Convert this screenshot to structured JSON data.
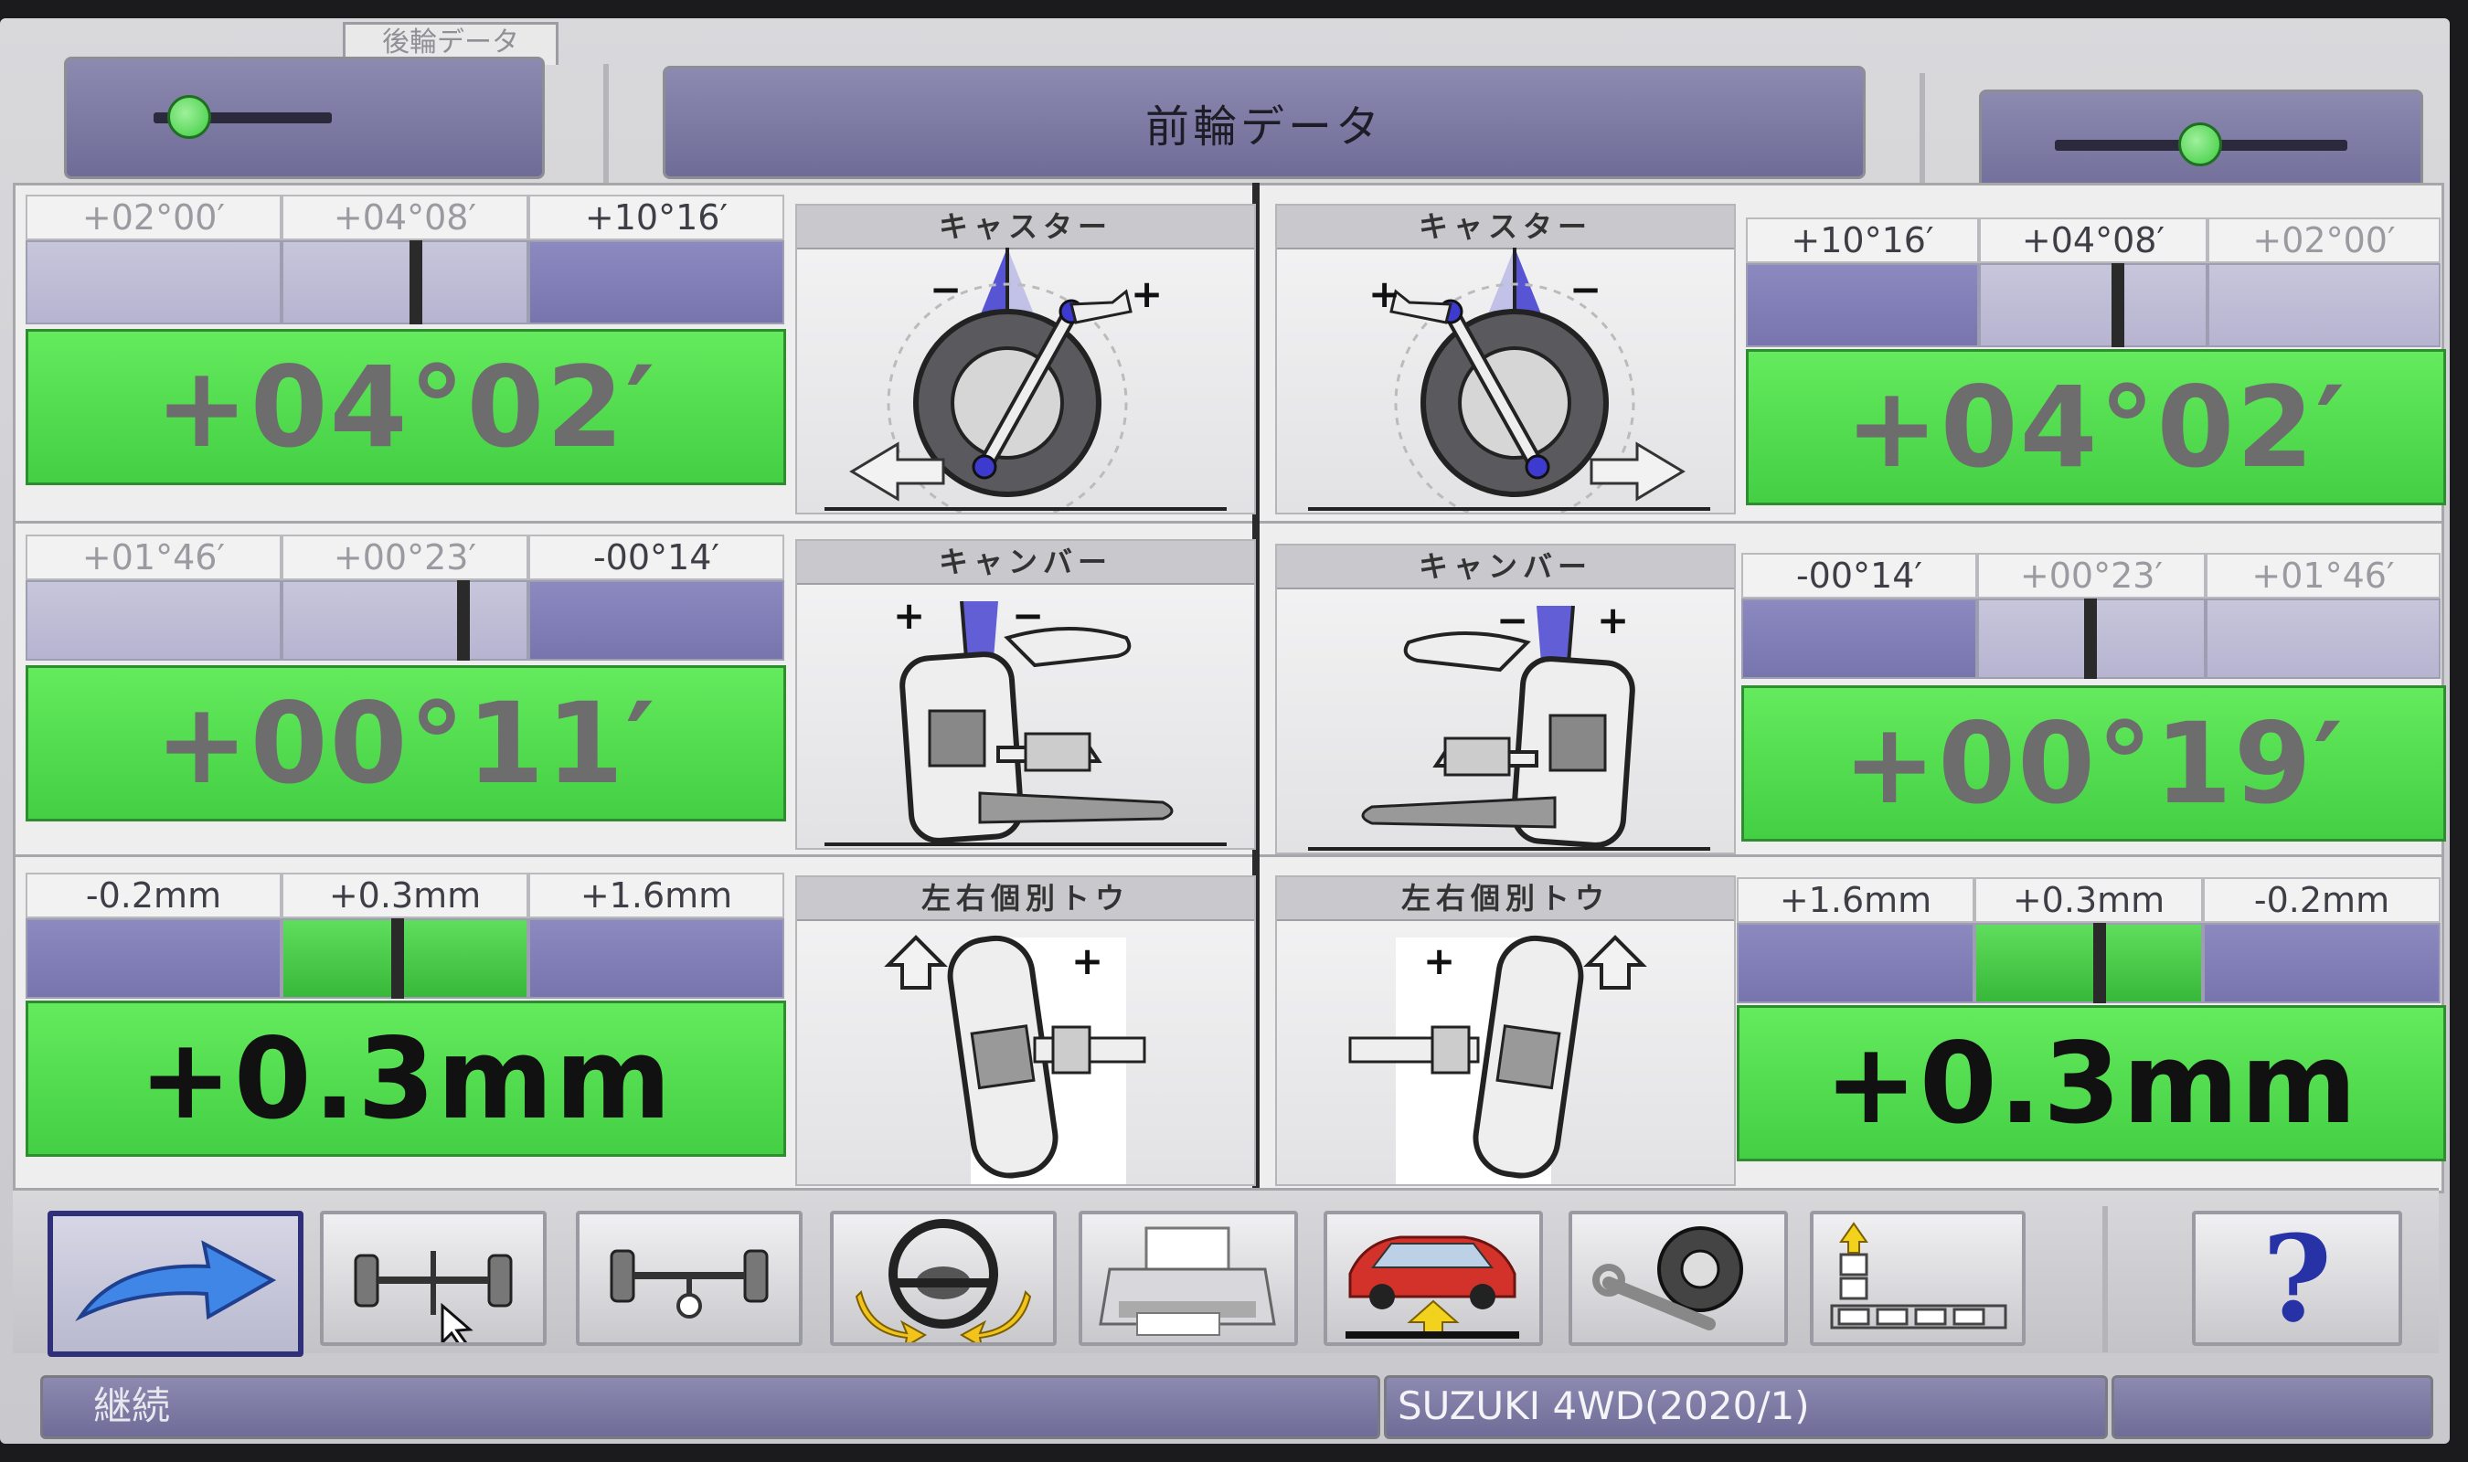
{
  "header": {
    "title": "前輪データ",
    "rear_tab": "後輪データ"
  },
  "rows": [
    {
      "left": {
        "ranges": [
          "+02°00′",
          "+04°08′",
          "+10°16′"
        ],
        "value": "+04°02′",
        "status": "neutral"
      },
      "left_caption": "キャスター",
      "right_caption": "キャスター",
      "right": {
        "ranges": [
          "+10°16′",
          "+04°08′",
          "+02°00′"
        ],
        "value": "+04°02′",
        "status": "neutral"
      }
    },
    {
      "left": {
        "ranges": [
          "+01°46′",
          "+00°23′",
          "-00°14′"
        ],
        "value": "+00°11′",
        "status": "neutral"
      },
      "left_caption": "キャンバー",
      "right_caption": "キャンバー",
      "right": {
        "ranges": [
          "-00°14′",
          "+00°23′",
          "+01°46′"
        ],
        "value": "+00°19′",
        "status": "neutral"
      }
    },
    {
      "left": {
        "ranges": [
          "-0.2mm",
          "+0.3mm",
          "+1.6mm"
        ],
        "value": "+0.3mm",
        "status": "ok"
      },
      "left_caption": "左右個別トウ",
      "right_caption": "左右個別トウ",
      "right": {
        "ranges": [
          "+1.6mm",
          "+0.3mm",
          "-0.2mm"
        ],
        "value": "+0.3mm",
        "status": "ok"
      }
    }
  ],
  "toolbar": {
    "buttons": [
      "next-arrow",
      "front-axle",
      "rear-axle",
      "steering-wheel",
      "printer",
      "car-lift",
      "tools-wheel",
      "level-bars",
      "help"
    ],
    "help_label": "?"
  },
  "status": {
    "left": "継続",
    "middle": "SUZUKI 4WD(2020/1)",
    "right": ""
  },
  "colors": {
    "ok_green": "#44cf44",
    "bar_purple": "#7874ad",
    "frame_gray": "#d2d2d5"
  }
}
